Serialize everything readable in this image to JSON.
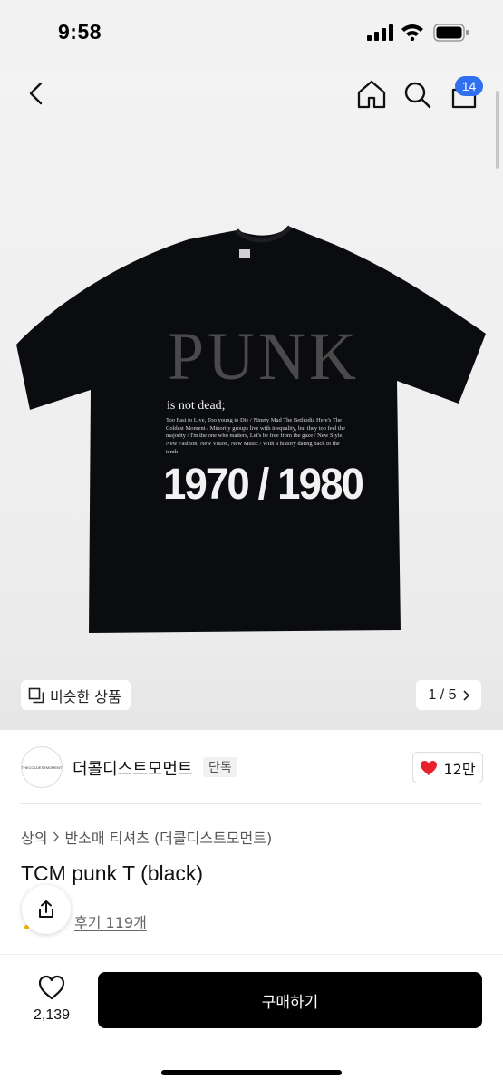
{
  "status_bar": {
    "time": "9:58"
  },
  "nav": {
    "cart_count": "14"
  },
  "image": {
    "print_title": "PUNK",
    "print_subtitle": "is not dead;",
    "print_copy": "Too Fast to Live, Too young to Die / Ninety Mad The Bethodia Here's The Coldest Moment / Minority groups live with inequality, but they too feel the majority / I'm the one who matters, Let's be free from the gaze / New Style, New Fashion, New Vision, New Music / With a history dating back to the tenth",
    "print_years": "1970 / 1980",
    "similar_label": "비슷한 상품",
    "pager": "1 / 5"
  },
  "brand": {
    "logo_text": "THECOLDESTMOMENT",
    "name": "더콜디스트모먼트",
    "tag": "단독",
    "likes": "12만"
  },
  "breadcrumb": {
    "category": "상의",
    "subcategory": "반소매 티셔츠 (더콜디스트모먼트)"
  },
  "product": {
    "title": "TCM punk T (black)",
    "reviews": "후기 119개"
  },
  "bottom_bar": {
    "wish_count": "2,139",
    "buy_label": "구매하기"
  },
  "colors": {
    "accent_badge": "#2f6ff0",
    "heart": "#e8212e",
    "buy_button": "#000000"
  }
}
